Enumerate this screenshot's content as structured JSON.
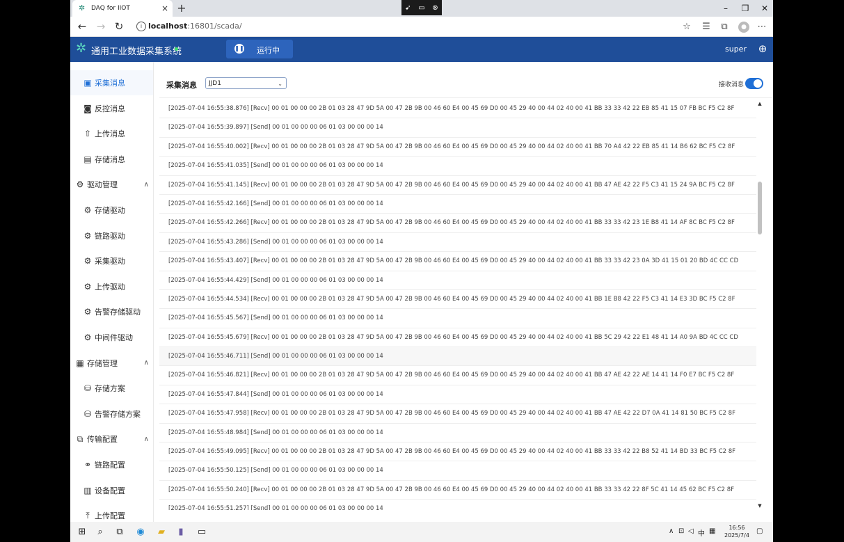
{
  "browser": {
    "tab_title": "DAQ for IIOT",
    "tab_close": "×",
    "new_tab": "+",
    "url_host": "localhost",
    "url_rest": ":16801/scada/"
  },
  "header": {
    "title": "通用工业数据采集系统",
    "run_status": "运行中",
    "user": "super"
  },
  "sidebar": {
    "items": [
      {
        "label": "采集消息",
        "icon": "collect-icon",
        "glyph": "▣",
        "type": "child",
        "active": true
      },
      {
        "label": "反控消息",
        "icon": "control-icon",
        "glyph": "◙",
        "type": "child"
      },
      {
        "label": "上传消息",
        "icon": "upload-msg-icon",
        "glyph": "⇧",
        "type": "child"
      },
      {
        "label": "存储消息",
        "icon": "store-msg-icon",
        "glyph": "▤",
        "type": "child"
      },
      {
        "label": "驱动管理",
        "icon": "driver-icon",
        "glyph": "⚙",
        "type": "group"
      },
      {
        "label": "存储驱动",
        "icon": "gear-icon",
        "glyph": "⚙",
        "type": "child"
      },
      {
        "label": "链路驱动",
        "icon": "gear-icon",
        "glyph": "⚙",
        "type": "child"
      },
      {
        "label": "采集驱动",
        "icon": "gear-icon",
        "glyph": "⚙",
        "type": "child"
      },
      {
        "label": "上传驱动",
        "icon": "gear-icon",
        "glyph": "⚙",
        "type": "child"
      },
      {
        "label": "告警存储驱动",
        "icon": "gear-icon",
        "glyph": "⚙",
        "type": "child"
      },
      {
        "label": "中间件驱动",
        "icon": "gear-icon",
        "glyph": "⚙",
        "type": "child"
      },
      {
        "label": "存储管理",
        "icon": "storage-icon",
        "glyph": "▦",
        "type": "group"
      },
      {
        "label": "存储方案",
        "icon": "database-icon",
        "glyph": "⛁",
        "type": "child"
      },
      {
        "label": "告警存储方案",
        "icon": "database-icon",
        "glyph": "⛁",
        "type": "child"
      },
      {
        "label": "传输配置",
        "icon": "network-icon",
        "glyph": "⧉",
        "type": "group"
      },
      {
        "label": "链路配置",
        "icon": "link-icon",
        "glyph": "⚭",
        "type": "child"
      },
      {
        "label": "设备配置",
        "icon": "device-icon",
        "glyph": "▥",
        "type": "child"
      },
      {
        "label": "上传配置",
        "icon": "upload-icon",
        "glyph": "⤒",
        "type": "child"
      }
    ]
  },
  "main": {
    "label": "采集消息",
    "device_select": "JJD1",
    "receive_label": "接收消息",
    "receive_on": true,
    "logs": [
      "[2025-07-04 16:55:38.876] [Recv] 00 01 00 00 00 2B 01 03 28 47 9D 5A 00 47 2B 9B 00 46 60 E4 00 45 69 D0 00 45 29 40 00 44 02 40 00 41 BB 33 33 42 22 EB 85 41 15 07 FB BC F5 C2 8F",
      "[2025-07-04 16:55:39.897] [Send] 00 01 00 00 00 06 01 03 00 00 00 14",
      "[2025-07-04 16:55:40.002] [Recv] 00 01 00 00 00 2B 01 03 28 47 9D 5A 00 47 2B 9B 00 46 60 E4 00 45 69 D0 00 45 29 40 00 44 02 40 00 41 BB 70 A4 42 22 EB 85 41 14 B6 62 BC F5 C2 8F",
      "[2025-07-04 16:55:41.035] [Send] 00 01 00 00 00 06 01 03 00 00 00 14",
      "[2025-07-04 16:55:41.145] [Recv] 00 01 00 00 00 2B 01 03 28 47 9D 5A 00 47 2B 9B 00 46 60 E4 00 45 69 D0 00 45 29 40 00 44 02 40 00 41 BB 47 AE 42 22 F5 C3 41 15 24 9A BC F5 C2 8F",
      "[2025-07-04 16:55:42.166] [Send] 00 01 00 00 00 06 01 03 00 00 00 14",
      "[2025-07-04 16:55:42.266] [Recv] 00 01 00 00 00 2B 01 03 28 47 9D 5A 00 47 2B 9B 00 46 60 E4 00 45 69 D0 00 45 29 40 00 44 02 40 00 41 BB 33 33 42 23 1E B8 41 14 AF 8C BC F5 C2 8F",
      "[2025-07-04 16:55:43.286] [Send] 00 01 00 00 00 06 01 03 00 00 00 14",
      "[2025-07-04 16:55:43.407] [Recv] 00 01 00 00 00 2B 01 03 28 47 9D 5A 00 47 2B 9B 00 46 60 E4 00 45 69 D0 00 45 29 40 00 44 02 40 00 41 BB 33 33 42 23 0A 3D 41 15 01 20 BD 4C CC CD",
      "[2025-07-04 16:55:44.429] [Send] 00 01 00 00 00 06 01 03 00 00 00 14",
      "[2025-07-04 16:55:44.534] [Recv] 00 01 00 00 00 2B 01 03 28 47 9D 5A 00 47 2B 9B 00 46 60 E4 00 45 69 D0 00 45 29 40 00 44 02 40 00 41 BB 1E B8 42 22 F5 C3 41 14 E3 3D BC F5 C2 8F",
      "[2025-07-04 16:55:45.567] [Send] 00 01 00 00 00 06 01 03 00 00 00 14",
      "[2025-07-04 16:55:45.679] [Recv] 00 01 00 00 00 2B 01 03 28 47 9D 5A 00 47 2B 9B 00 46 60 E4 00 45 69 D0 00 45 29 40 00 44 02 40 00 41 BB 5C 29 42 22 E1 48 41 14 A0 9A BD 4C CC CD",
      "[2025-07-04 16:55:46.711] [Send] 00 01 00 00 00 06 01 03 00 00 00 14",
      "[2025-07-04 16:55:46.821] [Recv] 00 01 00 00 00 2B 01 03 28 47 9D 5A 00 47 2B 9B 00 46 60 E4 00 45 69 D0 00 45 29 40 00 44 02 40 00 41 BB 47 AE 42 22 AE 14 41 14 F0 E7 BC F5 C2 8F",
      "[2025-07-04 16:55:47.844] [Send] 00 01 00 00 00 06 01 03 00 00 00 14",
      "[2025-07-04 16:55:47.958] [Recv] 00 01 00 00 00 2B 01 03 28 47 9D 5A 00 47 2B 9B 00 46 60 E4 00 45 69 D0 00 45 29 40 00 44 02 40 00 41 BB 47 AE 42 22 D7 0A 41 14 81 50 BC F5 C2 8F",
      "[2025-07-04 16:55:48.984] [Send] 00 01 00 00 00 06 01 03 00 00 00 14",
      "[2025-07-04 16:55:49.095] [Recv] 00 01 00 00 00 2B 01 03 28 47 9D 5A 00 47 2B 9B 00 46 60 E4 00 45 69 D0 00 45 29 40 00 44 02 40 00 41 BB 33 33 42 22 B8 52 41 14 BD 33 BC F5 C2 8F",
      "[2025-07-04 16:55:50.125] [Send] 00 01 00 00 00 06 01 03 00 00 00 14",
      "[2025-07-04 16:55:50.240] [Recv] 00 01 00 00 00 2B 01 03 28 47 9D 5A 00 47 2B 9B 00 46 60 E4 00 45 69 D0 00 45 29 40 00 44 02 40 00 41 BB 33 33 42 22 8F 5C 41 14 45 62 BC F5 C2 8F",
      "[2025-07-04 16:55:51.257] [Send] 00 01 00 00 00 06 01 03 00 00 00 14"
    ],
    "highlight_index": 13
  },
  "taskbar": {
    "ime": "中",
    "time": "16:56",
    "date": "2025/7/4"
  },
  "colors": {
    "header_bg": "#1f4e99",
    "accent": "#1f6fd6",
    "status_dot": "#3ee06a"
  }
}
